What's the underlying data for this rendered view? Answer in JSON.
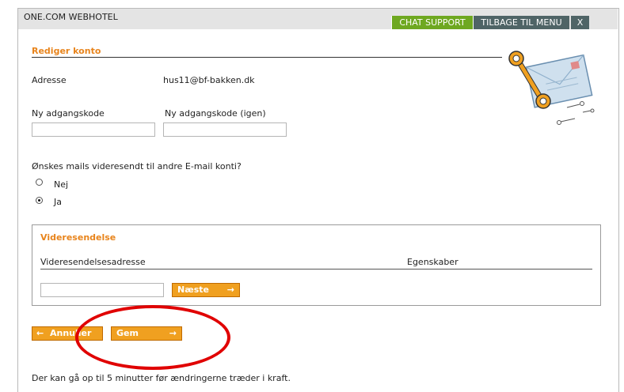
{
  "header": {
    "app_title": "ONE.COM WEBHOTEL",
    "chat_support": "CHAT SUPPORT",
    "back_to_menu": "TILBAGE TIL MENU",
    "close": "X"
  },
  "form": {
    "section_title": "Rediger konto",
    "address_label": "Adresse",
    "address_value": "hus11@bf-bakken.dk",
    "new_password_label": "Ny adgangskode",
    "new_password_value": "",
    "repeat_password_label": "Ny adgangskode (igen)",
    "repeat_password_value": "",
    "forward_question": "Ønskes mails videresendt til andre E-mail konti?",
    "forward_options": [
      {
        "label": "Nej",
        "selected": false
      },
      {
        "label": "Ja",
        "selected": true
      }
    ]
  },
  "forwarding": {
    "title": "Videresendelse",
    "col_address": "Videresendelsesadresse",
    "col_properties": "Egenskaber",
    "new_address_value": "",
    "next_button": "Næste",
    "next_arrow": "→"
  },
  "actions": {
    "cancel_label": "Annuller",
    "cancel_arrow": "←",
    "save_label": "Gem",
    "save_arrow": "→"
  },
  "footer_note": "Der kan gå op til 5 minutter før ændringerne træder i kraft.",
  "colors": {
    "accent_orange": "#e8841c",
    "chat_green": "#6ea820",
    "nav_gray": "#4f6466",
    "highlight_red": "#e00000"
  },
  "icons": {
    "illustration": "envelope-with-key-icon"
  }
}
